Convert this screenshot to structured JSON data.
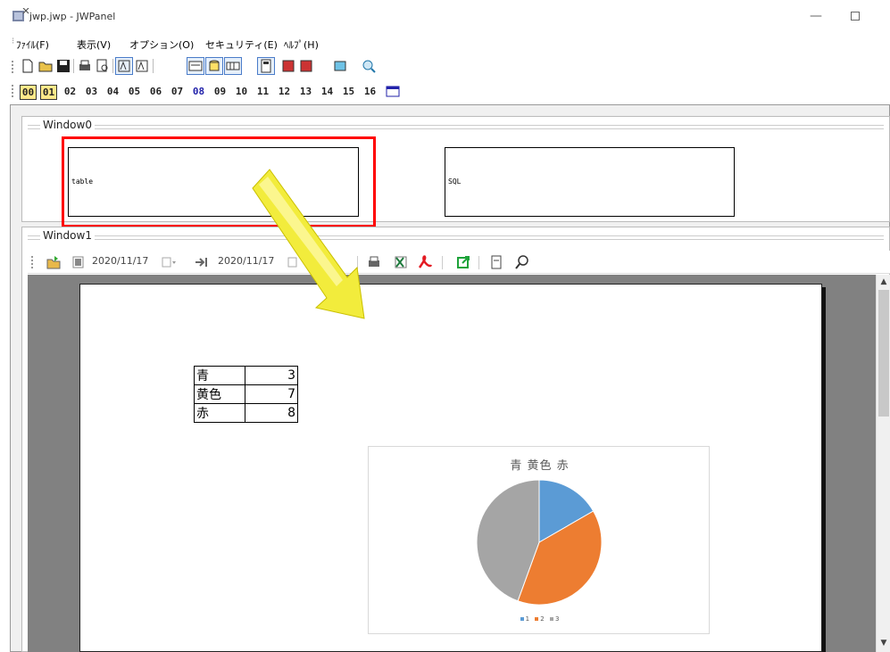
{
  "window": {
    "title": "jwp.jwp - JWPanel"
  },
  "menu": [
    "ﾌｧｲﾙ(F)",
    "表示(V)",
    "オプション(O)",
    "セキュリティ(E)",
    "ﾍﾙﾌﾟ(H)"
  ],
  "pages": [
    "00",
    "01",
    "02",
    "03",
    "04",
    "05",
    "06",
    "07",
    "08",
    "09",
    "10",
    "11",
    "12",
    "13",
    "14",
    "15",
    "16"
  ],
  "panels": {
    "window0": {
      "title": "Window0",
      "box_table": "table",
      "box_sql": "SQL"
    },
    "window1": {
      "title": "Window1"
    }
  },
  "report_toolbar": {
    "date_from": "2020/11/17",
    "date_to": "2020/11/17"
  },
  "table": [
    {
      "key": "青",
      "value": "3"
    },
    {
      "key": "黄色",
      "value": "7"
    },
    {
      "key": "赤",
      "value": "8"
    }
  ],
  "chart_data": {
    "type": "pie",
    "title": "青 黄色 赤",
    "categories": [
      "1",
      "2",
      "3"
    ],
    "values": [
      3,
      7,
      8
    ],
    "colors": [
      "#5b9bd5",
      "#ed7d31",
      "#a5a5a5"
    ],
    "legend": "bottom"
  },
  "colors": {
    "highlight": "#ff0000",
    "arrow": "#f2ec3c"
  }
}
